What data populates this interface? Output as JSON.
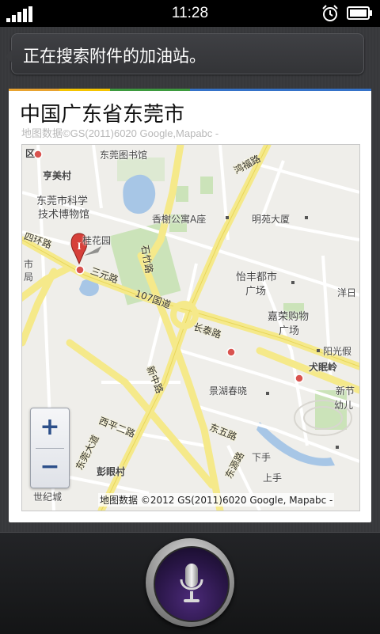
{
  "status_bar": {
    "time": "11:28",
    "signal_icon": "signal-icon",
    "alarm_icon": "alarm-icon",
    "battery_icon": "battery-icon"
  },
  "siri": {
    "query_text": "正在搜索附件的加油站。"
  },
  "map_card": {
    "title": "中国广东省东莞市",
    "credit": "地图数据©GS(2011)6020 Google,Mapabc -",
    "map_credit": "地图数据 ©2012 GS(2011)6020 Google, Mapabc -",
    "zoom_in_label": "+",
    "zoom_out_label": "−",
    "pin_letter": "I",
    "labels": {
      "qu": "区",
      "dongguan_library": "东莞图书馆",
      "wan_shuilu": "鸿福路",
      "hengmeicun": "亨美村",
      "science_museum_1": "东莞市科学",
      "science_museum_2": "技术博物馆",
      "xiangxie": "香榭公寓A座",
      "mingyuan": "明苑大厦",
      "guihuayuan": "桂花园",
      "shizhu_road": "石竹路",
      "siheng_road": "四环路",
      "sanyuan_road": "三元路",
      "road107": "107国道",
      "shi": "市",
      "ju": "局",
      "yifeng_1": "怡丰都市",
      "yifeng_2": "广场",
      "jiarong_1": "嘉荣购物",
      "jiarong_2": "广场",
      "yangguang": "阳光假",
      "changtai_road": "长泰路",
      "quanquan_road": "犬眠岭",
      "xinzhong_road": "新中路",
      "jinghu": "景湖春晓",
      "xinjie_1": "新节",
      "xinjie_2": "幼儿",
      "xiping_road": "西平二路",
      "dongwu_road": "东五路",
      "dongguan_ave": "东莞大道",
      "dongyuan_road": "东源路",
      "pengyincun": "彭眼村",
      "xiashou": "下手",
      "shangshou": "上手",
      "shiji": "世纪城",
      "yangxi": "洋日"
    }
  }
}
